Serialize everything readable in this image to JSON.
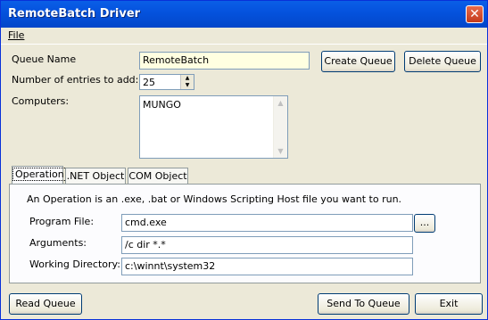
{
  "window": {
    "title": "RemoteBatch Driver",
    "close_glyph": "✕"
  },
  "menu": {
    "file_label": "File"
  },
  "queue_name": {
    "label": "Queue Name",
    "value": "RemoteBatch"
  },
  "entries": {
    "label": "Number of entries to add:",
    "value": "25"
  },
  "computers": {
    "label": "Computers:",
    "items": [
      "MUNGO"
    ]
  },
  "buttons": {
    "create_queue": "Create Queue",
    "delete_queue": "Delete Queue",
    "read_queue": "Read Queue",
    "send_to_queue": "Send To Queue",
    "exit": "Exit",
    "browse": "..."
  },
  "tabs": [
    {
      "label": "Operation",
      "active": true
    },
    {
      "label": ".NET Object"
    },
    {
      "label": "COM Object"
    }
  ],
  "operation": {
    "description": "An Operation is an .exe, .bat or Windows Scripting Host file you want to run.",
    "program_file": {
      "label": "Program File:",
      "value": "cmd.exe"
    },
    "arguments": {
      "label": "Arguments:",
      "value": "/c dir *.*"
    },
    "working_directory": {
      "label": "Working Directory:",
      "value": "c:\\winnt\\system32"
    }
  },
  "colors": {
    "titlebar": "#0553de",
    "queue_name_bg": "#ffffe1",
    "face": "#ece9d8"
  },
  "icons": {
    "close": "close-icon",
    "spin_up": "arrow-up-icon",
    "spin_down": "arrow-down-icon",
    "scroll_up": "arrow-up-icon",
    "scroll_down": "arrow-down-icon"
  }
}
